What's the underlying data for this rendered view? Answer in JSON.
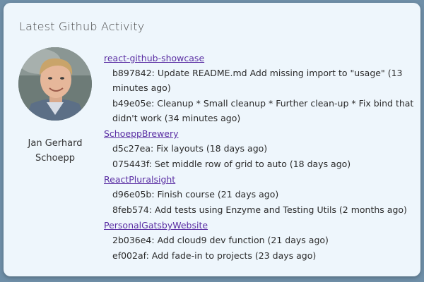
{
  "card": {
    "title": "Latest Github Activity"
  },
  "profile": {
    "name_line1": "Jan Gerhard",
    "name_line2": "Schoepp"
  },
  "repos": [
    {
      "name": "react-github-showcase",
      "commits": [
        {
          "text": "b897842: Update README.md Add missing import to \"usage\" (13 minutes ago)"
        },
        {
          "text": "b49e05e: Cleanup * Small cleanup * Further clean-up * Fix bind that didn't work (34 minutes ago)"
        }
      ]
    },
    {
      "name": "SchoeppBrewery",
      "commits": [
        {
          "text": "d5c27ea: Fix layouts (18 days ago)"
        },
        {
          "text": "075443f: Set middle row of grid to auto (18 days ago)"
        }
      ]
    },
    {
      "name": "ReactPluralsight",
      "commits": [
        {
          "text": "d96e05b: Finish course (21 days ago)"
        },
        {
          "text": "8feb574: Add tests using Enzyme and Testing Utils (2 months ago)"
        }
      ]
    },
    {
      "name": "PersonalGatsbyWebsite",
      "commits": [
        {
          "text": "2b036e4: Add cloud9 dev function (21 days ago)"
        },
        {
          "text": "ef002af: Add fade-in to projects (23 days ago)"
        }
      ]
    }
  ],
  "colors": {
    "background": "#6f8fa8",
    "card": "#eef6fc",
    "link": "#5a2ea3"
  }
}
